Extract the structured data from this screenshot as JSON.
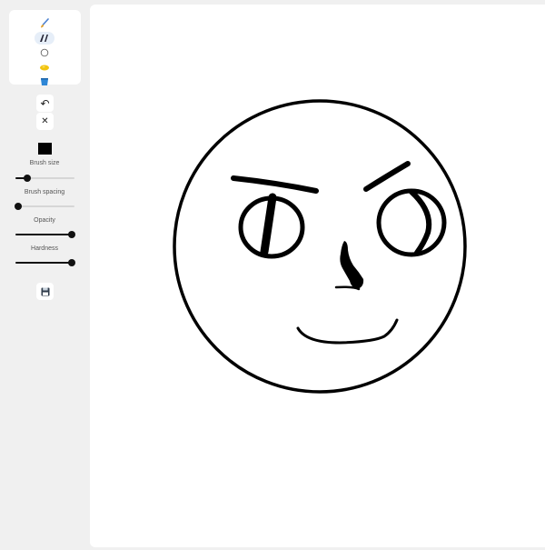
{
  "sidebar": {
    "tools": [
      {
        "icon": "paintbrush-icon",
        "glyph": "🖌",
        "selected": false
      },
      {
        "icon": "calligraphy-brush-icon",
        "glyph": "/\\\\",
        "selected": true
      },
      {
        "icon": "circle-shape-icon",
        "glyph": "◯",
        "selected": false
      },
      {
        "icon": "eraser-icon",
        "glyph": "🧽",
        "selected": false
      },
      {
        "icon": "paint-bucket-icon",
        "glyph": "🪣",
        "selected": false
      }
    ],
    "undo_glyph": "↶",
    "clear_glyph": "✕",
    "color": "#000000",
    "controls": [
      {
        "label": "Brush size",
        "value": 0.2
      },
      {
        "label": "Brush spacing",
        "value": 0.05
      },
      {
        "label": "Opacity",
        "value": 0.95
      },
      {
        "label": "Hardness",
        "value": 0.95
      }
    ],
    "save_glyph": "💾"
  },
  "canvas": {
    "background": "#ffffff",
    "stroke_color": "#000000"
  }
}
